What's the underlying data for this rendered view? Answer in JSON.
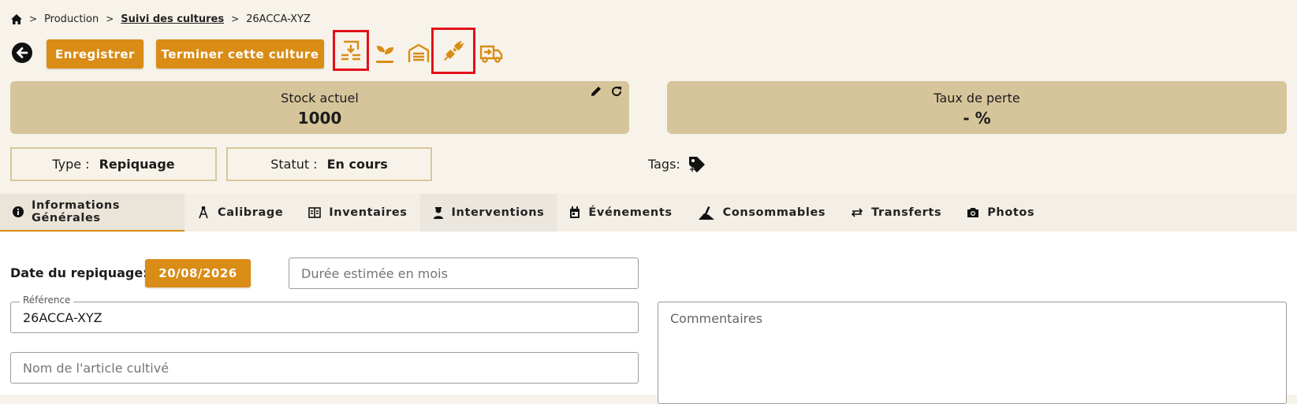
{
  "breadcrumb": {
    "items": [
      "Production",
      "Suivi des cultures",
      "26ACCA-XYZ"
    ]
  },
  "toolbar": {
    "save_label": "Enregistrer",
    "finish_label": "Terminer cette culture"
  },
  "stock_card": {
    "label": "Stock actuel",
    "value": "1000"
  },
  "loss_card": {
    "label": "Taux de perte",
    "value": "- %"
  },
  "type_box": {
    "label": "Type :",
    "value": "Repiquage"
  },
  "status_box": {
    "label": "Statut :",
    "value": "En cours"
  },
  "tags": {
    "label": "Tags:"
  },
  "tabs": [
    {
      "label": "Informations Générales",
      "icon": "info-icon"
    },
    {
      "label": "Calibrage",
      "icon": "calibration-icon"
    },
    {
      "label": "Inventaires",
      "icon": "inventory-icon"
    },
    {
      "label": "Interventions",
      "icon": "worker-icon"
    },
    {
      "label": "Événements",
      "icon": "calendar-icon"
    },
    {
      "label": "Consommables",
      "icon": "consumables-icon"
    },
    {
      "label": "Transferts",
      "icon": "transfer-icon"
    },
    {
      "label": "Photos",
      "icon": "camera-icon"
    }
  ],
  "form": {
    "date_label": "Date du repiquage:",
    "date_value": "20/08/2026",
    "duration_placeholder": "Durée estimée en mois",
    "reference_label": "Référence",
    "reference_value": "26ACCA-XYZ",
    "article_placeholder": "Nom de l'article cultivé",
    "comments_placeholder": "Commentaires"
  },
  "colors": {
    "accent": "#d98c16",
    "card": "#d6c59a",
    "highlight": "#e3101a"
  }
}
